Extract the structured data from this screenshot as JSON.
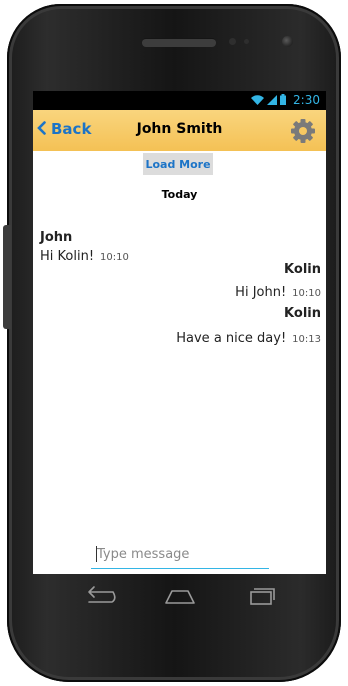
{
  "status_bar": {
    "time": "2:30"
  },
  "app_bar": {
    "back_label": "Back",
    "title": "John Smith",
    "settings_icon": "gear-icon"
  },
  "chat": {
    "load_more_label": "Load More",
    "day_label": "Today",
    "messages": [
      {
        "sender": "John",
        "text": "Hi Kolin!",
        "time": "10:10",
        "side": "left"
      },
      {
        "sender": "Kolin",
        "text": "Hi John!",
        "time": "10:10",
        "side": "right"
      },
      {
        "sender": "Kolin",
        "text": "Have a nice day!",
        "time": "10:13",
        "side": "right"
      }
    ]
  },
  "composer": {
    "placeholder": "Type message"
  },
  "colors": {
    "accent": "#1c74c7",
    "app_bar": "#f4c155",
    "status_icons": "#33b5e5"
  }
}
